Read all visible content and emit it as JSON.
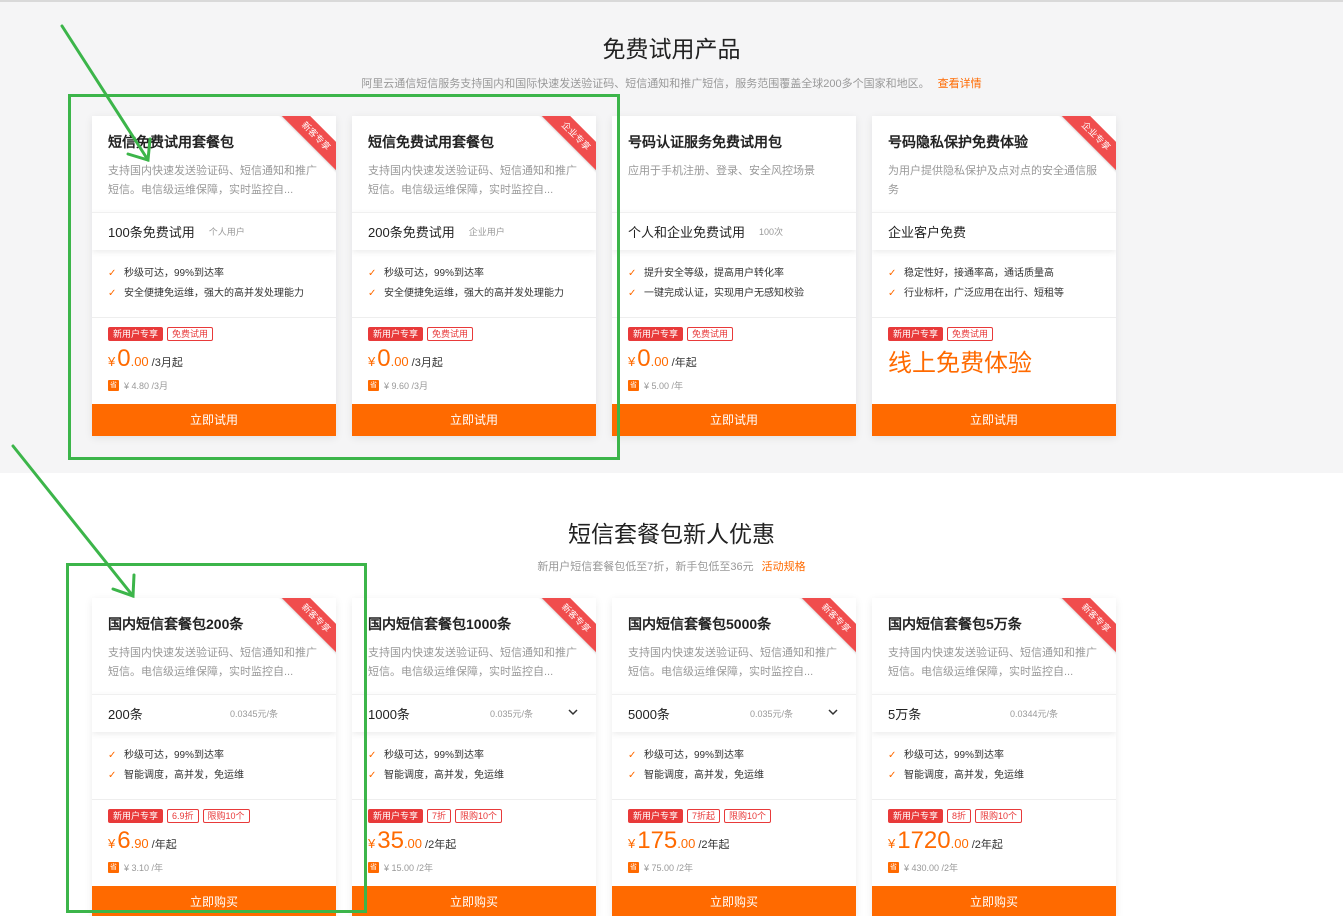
{
  "section1": {
    "title": "免费试用产品",
    "subtitle": "阿里云通信短信服务支持国内和国际快速发送验证码、短信通知和推广短信，服务范围覆盖全球200多个国家和地区。",
    "link": "查看详情",
    "cards": [
      {
        "name": "短信免费试用套餐包",
        "desc": "支持国内快速发送验证码、短信通知和推广短信。电信级运维保障，实时监控自...",
        "ribbon": "新客专享",
        "spec_main": "100条免费试用",
        "spec_sub": "个人用户",
        "features": [
          "秒级可达，99%到达率",
          "安全便捷免运维，强大的高并发处理能力"
        ],
        "tags": [
          "新用户专享",
          "免费试用"
        ],
        "price_currency": "¥",
        "price_int": "0",
        "price_dec": ".00",
        "price_unit": "/3月起",
        "orig_icon": "省",
        "orig_price": "¥ 4.80 /3月",
        "button": "立即试用"
      },
      {
        "name": "短信免费试用套餐包",
        "desc": "支持国内快速发送验证码、短信通知和推广短信。电信级运维保障，实时监控自...",
        "ribbon": "企业专享",
        "spec_main": "200条免费试用",
        "spec_sub": "企业用户",
        "features": [
          "秒级可达，99%到达率",
          "安全便捷免运维，强大的高并发处理能力"
        ],
        "tags": [
          "新用户专享",
          "免费试用"
        ],
        "price_currency": "¥",
        "price_int": "0",
        "price_dec": ".00",
        "price_unit": "/3月起",
        "orig_icon": "省",
        "orig_price": "¥ 9.60 /3月",
        "button": "立即试用"
      },
      {
        "name": "号码认证服务免费试用包",
        "desc": "应用于手机注册、登录、安全风控场景",
        "ribbon": "",
        "spec_main": "个人和企业免费试用",
        "spec_sub": "100次",
        "features": [
          "提升安全等级，提高用户转化率",
          "一键完成认证，实现用户无感知校验"
        ],
        "tags": [
          "新用户专享",
          "免费试用"
        ],
        "price_currency": "¥",
        "price_int": "0",
        "price_dec": ".00",
        "price_unit": "/年起",
        "orig_icon": "省",
        "orig_price": "¥ 5.00 /年",
        "button": "立即试用"
      },
      {
        "name": "号码隐私保护免费体验",
        "desc": "为用户提供隐私保护及点对点的安全通信服务",
        "ribbon": "企业专享",
        "spec_main": "企业客户免费",
        "spec_sub": "",
        "features": [
          "稳定性好，接通率高，通话质量高",
          "行业标杆，广泛应用在出行、短租等"
        ],
        "tags": [
          "新用户专享",
          "免费试用"
        ],
        "free_text": "线上免费体验",
        "button": "立即试用"
      }
    ]
  },
  "section2": {
    "title": "短信套餐包新人优惠",
    "subtitle": "新用户短信套餐包低至7折，新手包低至36元",
    "link": "活动规格",
    "cards": [
      {
        "name": "国内短信套餐包200条",
        "desc": "支持国内快速发送验证码、短信通知和推广短信。电信级运维保障，实时监控自...",
        "ribbon": "新客专享",
        "spec_main": "200条",
        "spec_sub": "0.0345元/条",
        "has_dropdown": false,
        "features": [
          "秒级可达，99%到达率",
          "智能调度，高并发，免运维"
        ],
        "tags": [
          "新用户专享",
          "6.9折",
          "限购10个"
        ],
        "price_currency": "¥",
        "price_int": "6",
        "price_dec": ".90",
        "price_unit": "/年起",
        "orig_icon": "省",
        "orig_price": "¥ 3.10 /年",
        "button": "立即购买"
      },
      {
        "name": "国内短信套餐包1000条",
        "desc": "支持国内快速发送验证码、短信通知和推广短信。电信级运维保障，实时监控自...",
        "ribbon": "新客专享",
        "spec_main": "1000条",
        "spec_sub": "0.035元/条",
        "has_dropdown": true,
        "features": [
          "秒级可达，99%到达率",
          "智能调度，高并发，免运维"
        ],
        "tags": [
          "新用户专享",
          "7折",
          "限购10个"
        ],
        "price_currency": "¥",
        "price_int": "35",
        "price_dec": ".00",
        "price_unit": "/2年起",
        "orig_icon": "省",
        "orig_price": "¥ 15.00 /2年",
        "button": "立即购买"
      },
      {
        "name": "国内短信套餐包5000条",
        "desc": "支持国内快速发送验证码、短信通知和推广短信。电信级运维保障，实时监控自...",
        "ribbon": "新客专享",
        "spec_main": "5000条",
        "spec_sub": "0.035元/条",
        "has_dropdown": true,
        "features": [
          "秒级可达，99%到达率",
          "智能调度，高并发，免运维"
        ],
        "tags": [
          "新用户专享",
          "7折起",
          "限购10个"
        ],
        "price_currency": "¥",
        "price_int": "175",
        "price_dec": ".00",
        "price_unit": "/2年起",
        "orig_icon": "省",
        "orig_price": "¥ 75.00 /2年",
        "button": "立即购买"
      },
      {
        "name": "国内短信套餐包5万条",
        "desc": "支持国内快速发送验证码、短信通知和推广短信。电信级运维保障，实时监控自...",
        "ribbon": "新客专享",
        "spec_main": "5万条",
        "spec_sub": "0.0344元/条",
        "has_dropdown": false,
        "features": [
          "秒级可达，99%到达率",
          "智能调度，高并发，免运维"
        ],
        "tags": [
          "新用户专享",
          "8折",
          "限购10个"
        ],
        "price_currency": "¥",
        "price_int": "1720",
        "price_dec": ".00",
        "price_unit": "/2年起",
        "orig_icon": "省",
        "orig_price": "¥ 430.00 /2年",
        "button": "立即购买"
      }
    ]
  },
  "colors": {
    "accent": "#ff6a00",
    "tag_red": "#e83a3a",
    "ribbon": "#f04d4d",
    "annotation": "#3cb54a",
    "section1_bg": "#f5f5f6"
  },
  "icons": {
    "check": "check-icon",
    "dropdown": "chevron-down-icon",
    "save": "save-badge-icon"
  }
}
